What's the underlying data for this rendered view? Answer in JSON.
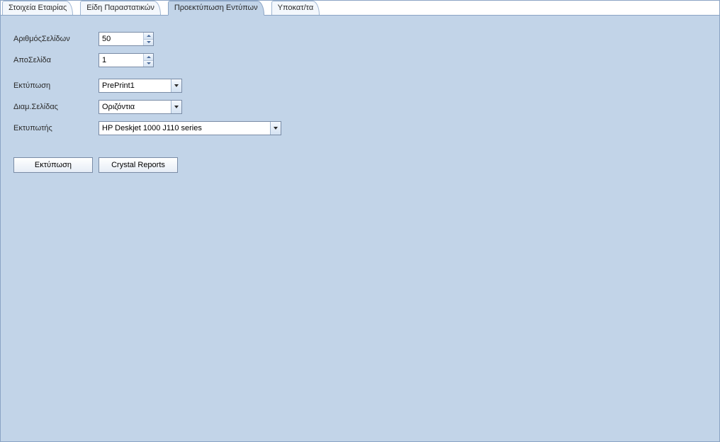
{
  "tabs": {
    "t0": "Στοιχεία Εταιρίας",
    "t1": "Είδη Παραστατικών",
    "t2": "Προεκτύπωση Εντύπων",
    "t3": "Υποκατ/τα"
  },
  "labels": {
    "num_pages": "ΑριθμόςΣελίδων",
    "from_page": "ΑποΣελίδα",
    "print_form": "Εκτύπωση",
    "page_layout": "Διαμ.Σελίδας",
    "printer": "Εκτυπωτής"
  },
  "values": {
    "num_pages": "50",
    "from_page": "1",
    "print_form": "PrePrint1",
    "page_layout": "Οριζόντια",
    "printer": "HP Deskjet 1000 J110 series"
  },
  "buttons": {
    "print": "Εκτύπωση",
    "reports": "Crystal Reports"
  }
}
